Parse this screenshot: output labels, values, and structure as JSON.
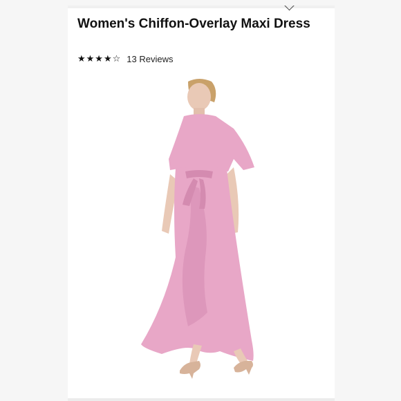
{
  "product": {
    "title": "Women's Chiffon-Overlay Maxi Dress",
    "rating_stars": "★★★★☆",
    "rating_value": 4,
    "rating_max": 5,
    "reviews_label": "13 Reviews"
  },
  "colors": {
    "dress": "#e8a7c7",
    "dress_shadow": "#d48bb0",
    "skin": "#e9c9b6",
    "hair": "#c9a16a",
    "shoes": "#d7b39a"
  }
}
